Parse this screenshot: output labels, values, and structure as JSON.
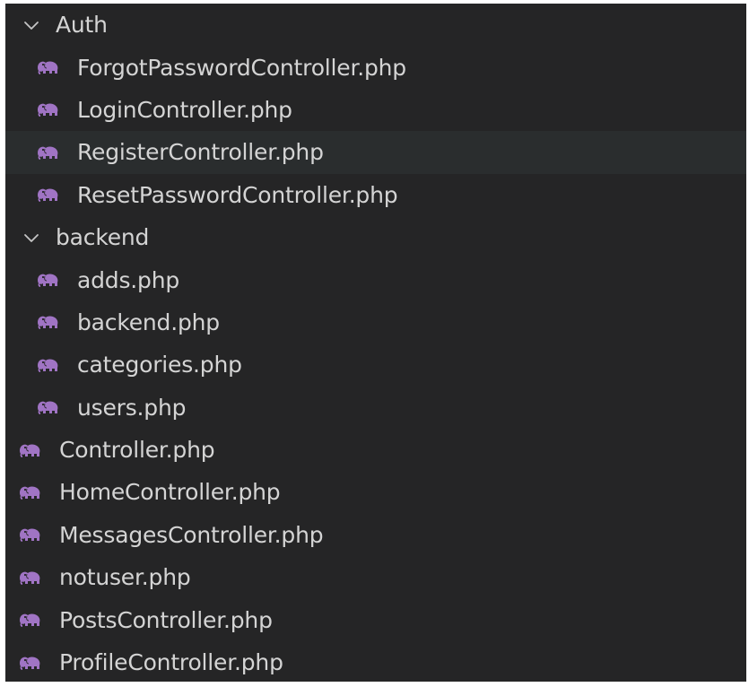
{
  "colors": {
    "panel_bg": "#252526",
    "hover_bg": "#2a2d2e",
    "text": "#d4d4d4",
    "php_icon": "#a074c4"
  },
  "tree": {
    "auth_folder": {
      "label": "Auth",
      "icon": "chevron-down-icon"
    },
    "auth_files": [
      {
        "label": "ForgotPasswordController.php",
        "icon": "php-elephant-icon"
      },
      {
        "label": "LoginController.php",
        "icon": "php-elephant-icon"
      },
      {
        "label": "RegisterController.php",
        "icon": "php-elephant-icon"
      },
      {
        "label": "ResetPasswordController.php",
        "icon": "php-elephant-icon"
      }
    ],
    "backend_folder": {
      "label": "backend",
      "icon": "chevron-down-icon"
    },
    "backend_files": [
      {
        "label": "adds.php",
        "icon": "php-elephant-icon"
      },
      {
        "label": "backend.php",
        "icon": "php-elephant-icon"
      },
      {
        "label": "categories.php",
        "icon": "php-elephant-icon"
      },
      {
        "label": "users.php",
        "icon": "php-elephant-icon"
      }
    ],
    "root_files": [
      {
        "label": "Controller.php",
        "icon": "php-elephant-icon"
      },
      {
        "label": "HomeController.php",
        "icon": "php-elephant-icon"
      },
      {
        "label": "MessagesController.php",
        "icon": "php-elephant-icon"
      },
      {
        "label": "notuser.php",
        "icon": "php-elephant-icon"
      },
      {
        "label": "PostsController.php",
        "icon": "php-elephant-icon"
      },
      {
        "label": "ProfileController.php",
        "icon": "php-elephant-icon"
      }
    ]
  }
}
